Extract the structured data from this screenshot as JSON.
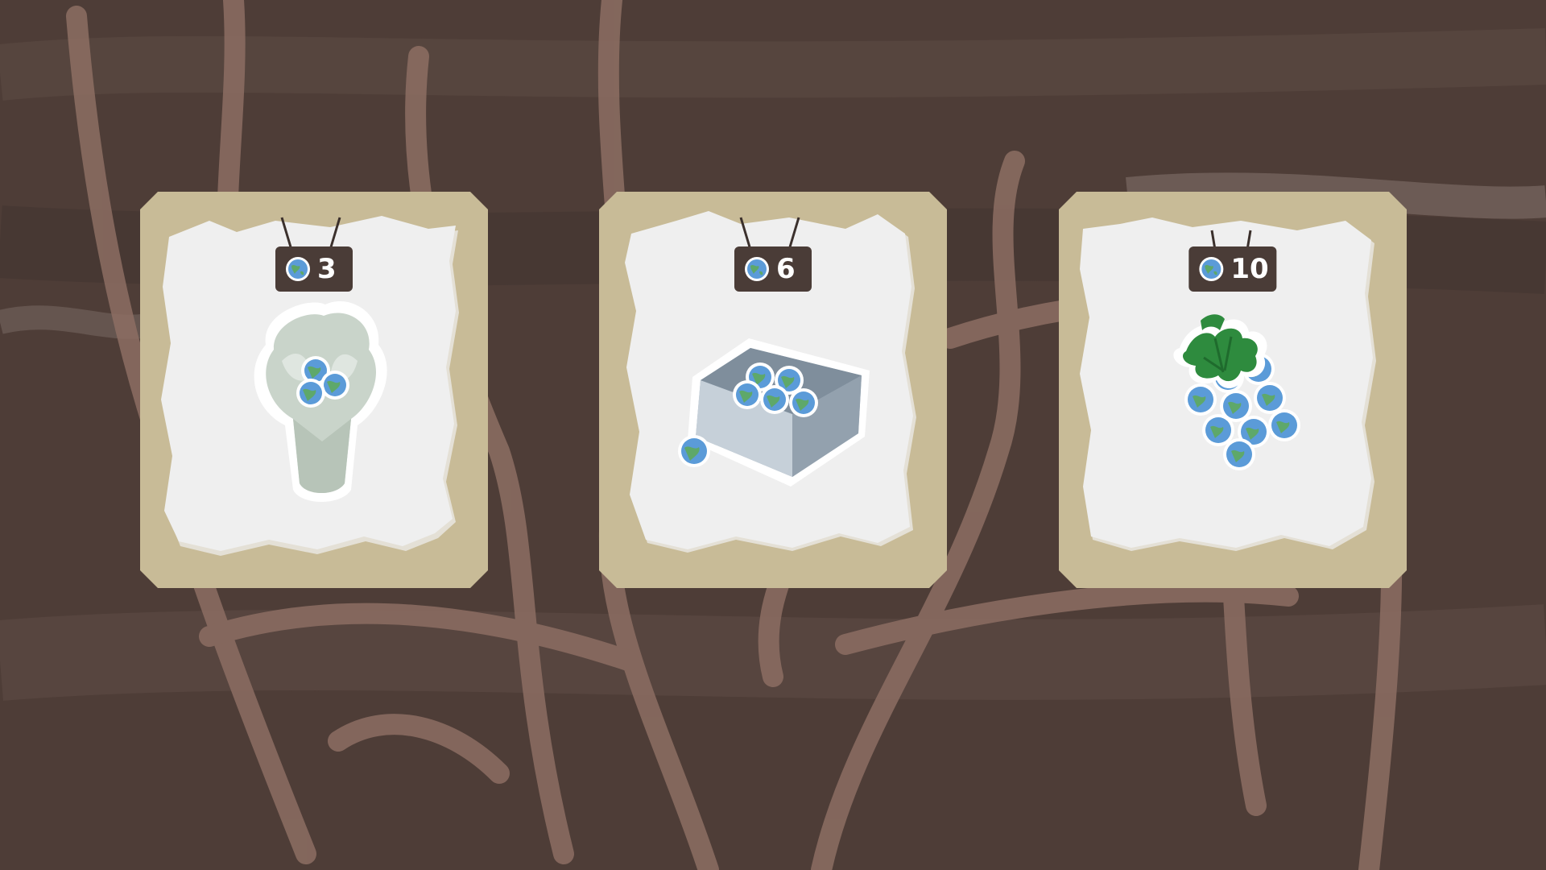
{
  "colors": {
    "background": "#4e3d37",
    "card_frame": "#c8bb97",
    "card_paper": "#efefef",
    "price_plate": "#4a3c37",
    "coin_blue": "#5b9bd8",
    "coin_green": "#5ea86a",
    "leaf_green": "#2e8b3e"
  },
  "shop": {
    "items": [
      {
        "id": "bouquet",
        "icon": "coin-bouquet-icon",
        "price": "3"
      },
      {
        "id": "crate",
        "icon": "coin-crate-icon",
        "price": "6"
      },
      {
        "id": "grapes",
        "icon": "coin-grapes-icon",
        "price": "10"
      }
    ]
  }
}
